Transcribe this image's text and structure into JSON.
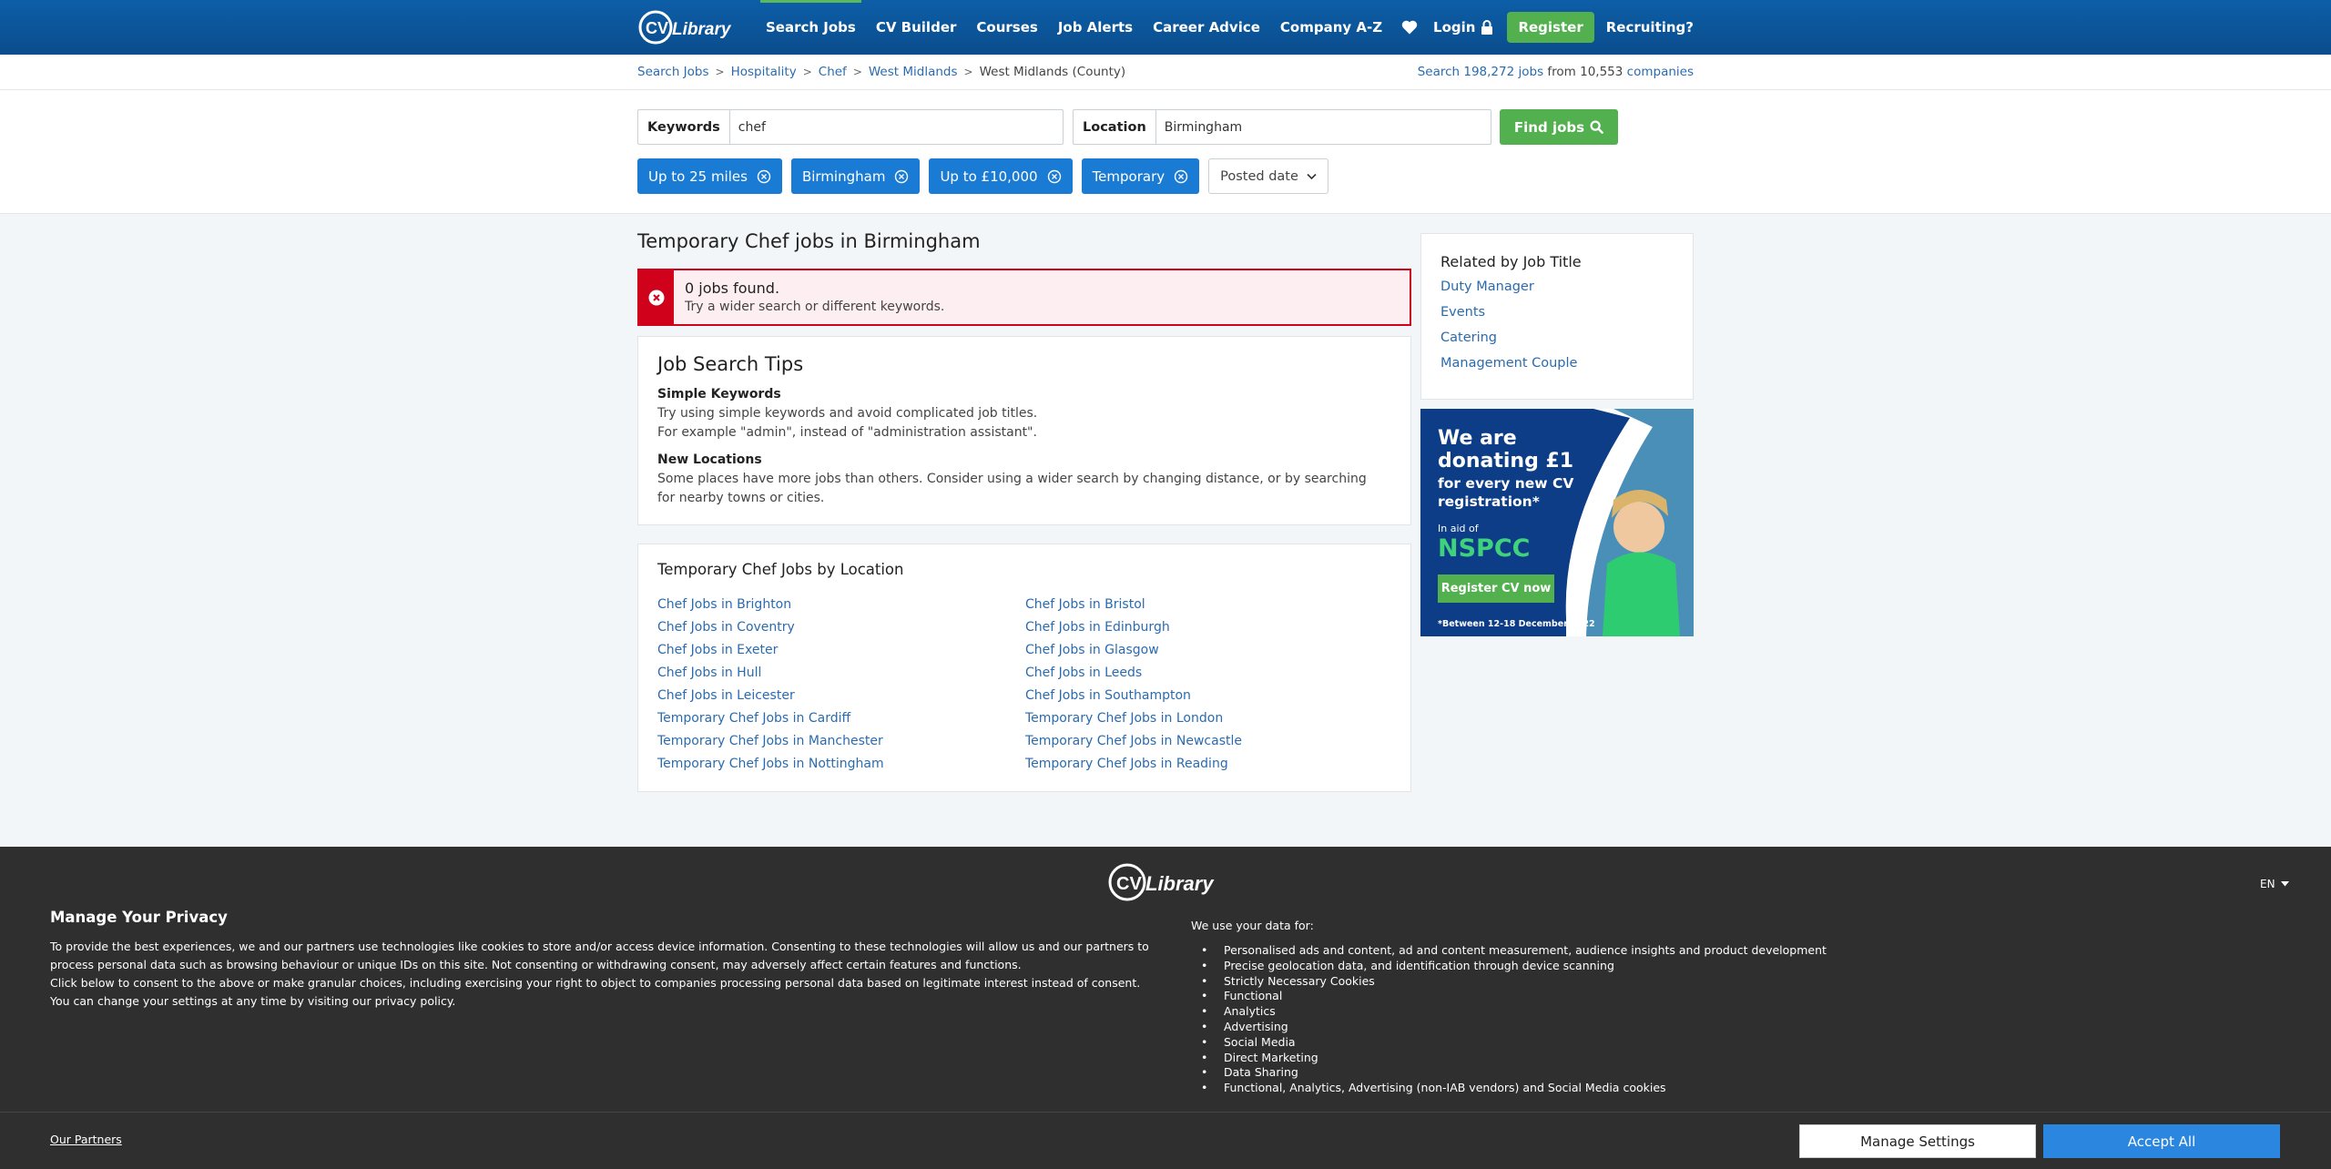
{
  "header": {
    "logo_text": "CV-Library",
    "nav": [
      "Search Jobs",
      "CV Builder",
      "Courses",
      "Job Alerts",
      "Career Advice",
      "Company A-Z"
    ],
    "login": "Login",
    "register": "Register",
    "recruiting": "Recruiting?"
  },
  "breadcrumb": {
    "items": [
      "Search Jobs",
      "Hospitality",
      "Chef",
      "West Midlands"
    ],
    "current": "West Midlands (County)"
  },
  "jobcount": {
    "prefix": "Search",
    "jobs": "198,272 jobs",
    "from": "from",
    "companies_num": "10,553",
    "companies": "companies"
  },
  "search": {
    "keywords_label": "Keywords",
    "keywords_value": "chef",
    "location_label": "Location",
    "location_value": "Birmingham",
    "find_label": "Find jobs"
  },
  "filters": [
    "Up to 25 miles",
    "Birmingham",
    "Up to £10,000",
    "Temporary"
  ],
  "sort": "Posted date",
  "main": {
    "title": "Temporary Chef jobs in Birmingham",
    "alert_title": "0 jobs found.",
    "alert_text": "Try a wider search or different keywords."
  },
  "tips": {
    "title": "Job Search Tips",
    "sub1": "Simple Keywords",
    "p1a": "Try using simple keywords and avoid complicated job titles.",
    "p1b": "For example \"admin\", instead of \"administration assistant\".",
    "sub2": "New Locations",
    "p2": "Some places have more jobs than others. Consider using a wider search by changing distance, or by searching for nearby towns or cities."
  },
  "locations": {
    "title": "Temporary Chef Jobs by Location",
    "links": [
      "Chef Jobs in Brighton",
      "Chef Jobs in Bristol",
      "Chef Jobs in Coventry",
      "Chef Jobs in Edinburgh",
      "Chef Jobs in Exeter",
      "Chef Jobs in Glasgow",
      "Chef Jobs in Hull",
      "Chef Jobs in Leeds",
      "Chef Jobs in Leicester",
      "Chef Jobs in Southampton",
      "Temporary Chef Jobs in Cardiff",
      "Temporary Chef Jobs in London",
      "Temporary Chef Jobs in Manchester",
      "Temporary Chef Jobs in Newcastle",
      "Temporary Chef Jobs in Nottingham",
      "Temporary Chef Jobs in Reading"
    ]
  },
  "related": {
    "title": "Related by Job Title",
    "links": [
      "Duty Manager",
      "Events",
      "Catering",
      "Management Couple"
    ]
  },
  "ad": {
    "line1": "We are",
    "line2": "donating £1",
    "line3": "for every new CV",
    "line4": "registration*",
    "aid": "In aid of",
    "charity": "NSPCC",
    "cta": "Register CV now",
    "footnote": "*Between 12-18 December 2022"
  },
  "privacy": {
    "lang": "EN",
    "title": "Manage Your Privacy",
    "text1": "To provide the best experiences, we and our partners use technologies like cookies to store and/or access device information. Consenting to these technologies will allow us and our partners to process personal data such as browsing behaviour or unique IDs on this site. Not consenting or withdrawing consent, may adversely affect certain features and functions.",
    "text2": "Click below to consent to the above or make granular choices, including exercising your right to object to companies processing personal data based on legitimate interest instead of consent. You can change your settings at any time by visiting our privacy policy.",
    "purposes_heading": "We use your data for:",
    "purposes": [
      "Personalised ads and content, ad and content measurement, audience insights and product development",
      "Precise geolocation data, and identification through device scanning",
      "Strictly Necessary Cookies",
      "Functional",
      "Analytics",
      "Advertising",
      "Social Media",
      "Direct Marketing",
      "Data Sharing",
      "Functional, Analytics, Advertising (non-IAB vendors) and Social Media cookies"
    ],
    "partners": "Our Partners",
    "manage": "Manage Settings",
    "accept": "Accept All"
  },
  "colors": {
    "header": "#0a4d8c",
    "accent_green": "#52b04e",
    "chip_blue": "#1a7bd4",
    "alert_red": "#d0021b",
    "link": "#2a6bb0",
    "accept_blue": "#2b86df"
  }
}
